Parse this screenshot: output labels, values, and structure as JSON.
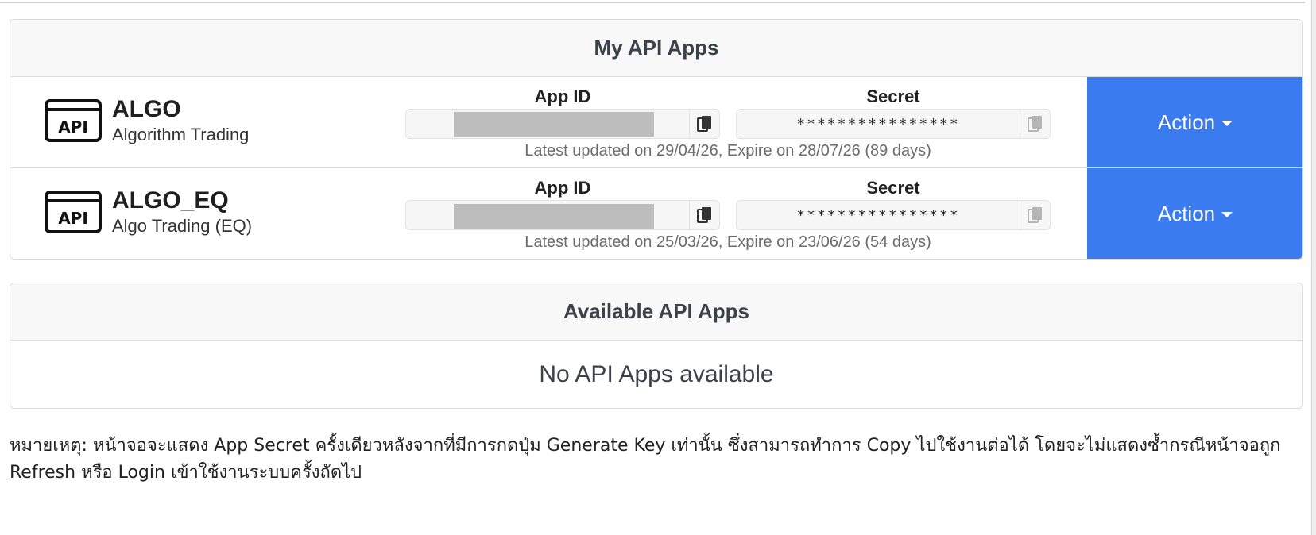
{
  "my_apps": {
    "title": "My API Apps",
    "apps": [
      {
        "icon": "api-icon",
        "icon_text": "API",
        "name": "ALGO",
        "description": "Algorithm Trading",
        "app_id_label": "App ID",
        "secret_label": "Secret",
        "secret_value": "****************",
        "updated_text": "Latest updated on 29/04/26, Expire on 28/07/26 (89 days)",
        "action_label": "Action"
      },
      {
        "icon": "api-icon",
        "icon_text": "API",
        "name": "ALGO_EQ",
        "description": "Algo Trading (EQ)",
        "app_id_label": "App ID",
        "secret_label": "Secret",
        "secret_value": "****************",
        "updated_text": "Latest updated on 25/03/26, Expire on 23/06/26 (54 days)",
        "action_label": "Action"
      }
    ]
  },
  "available_apps": {
    "title": "Available API Apps",
    "empty_message": "No API Apps available"
  },
  "note": "หมายเหตุ: หน้าจอจะแสดง App Secret ครั้งเดียวหลังจากที่มีการกดปุ่ม Generate Key เท่านั้น ซึ่งสามารถทำการ Copy ไปใช้งานต่อได้ โดยจะไม่แสดงซ้ำกรณีหน้าจอถูก Refresh หรือ Login เข้าใช้งานระบบครั้งถัดไป",
  "colors": {
    "action_button": "#3a7bf0",
    "masked_block": "#bdbdbd",
    "header_bg": "#f8f8f8"
  }
}
